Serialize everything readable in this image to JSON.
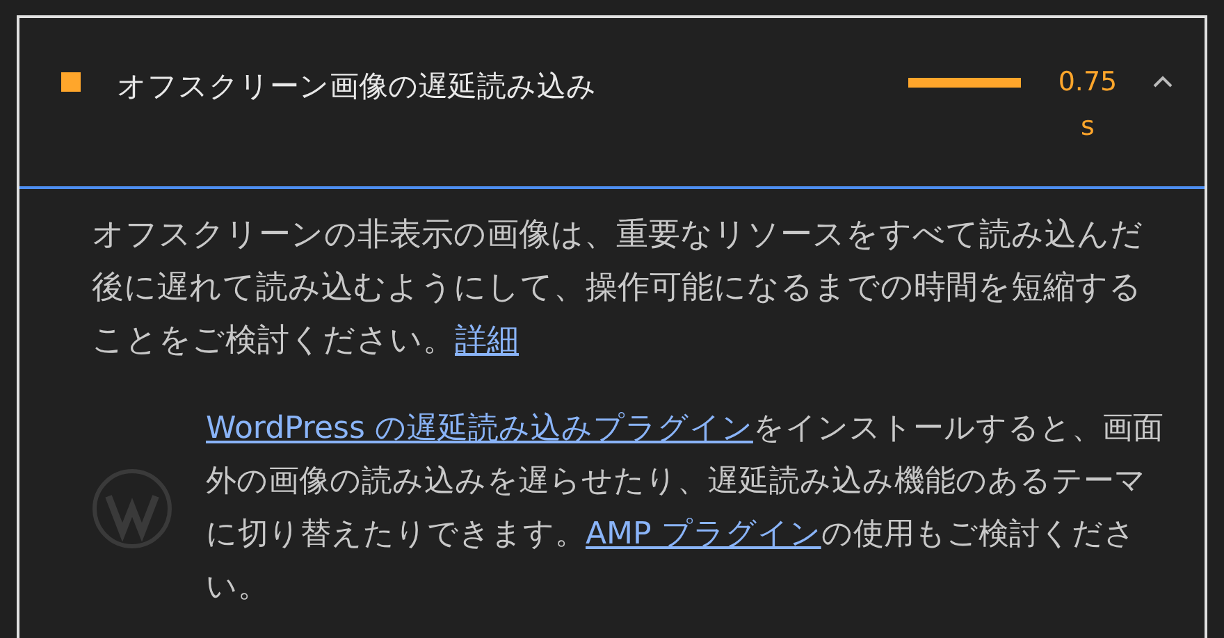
{
  "audit": {
    "title": "オフスクリーン画像の遅延読み込み",
    "color": "#ffa62b",
    "value": "0.75 s",
    "expanded": true
  },
  "description": [
    {
      "text": "オフスクリーンの非表示の画像は、重要なリソースをすべて読み込んだ後に遅れて読み込むようにして、操作可能になるまでの時間を短縮することをご検討ください。",
      "link": false
    },
    {
      "text": "詳細",
      "link": true
    }
  ],
  "stack_advice": [
    {
      "text": "WordPress の遅延読み込みプラグイン",
      "link": true
    },
    {
      "text": "をインストールすると、画面外の画像の読み込みを遅らせたり、遅延読み込み機能のあるテーマに切り替えたりできます。",
      "link": false
    },
    {
      "text": "AMP プラグイン",
      "link": true
    },
    {
      "text": "の使用もご検討ください。",
      "link": false
    }
  ]
}
